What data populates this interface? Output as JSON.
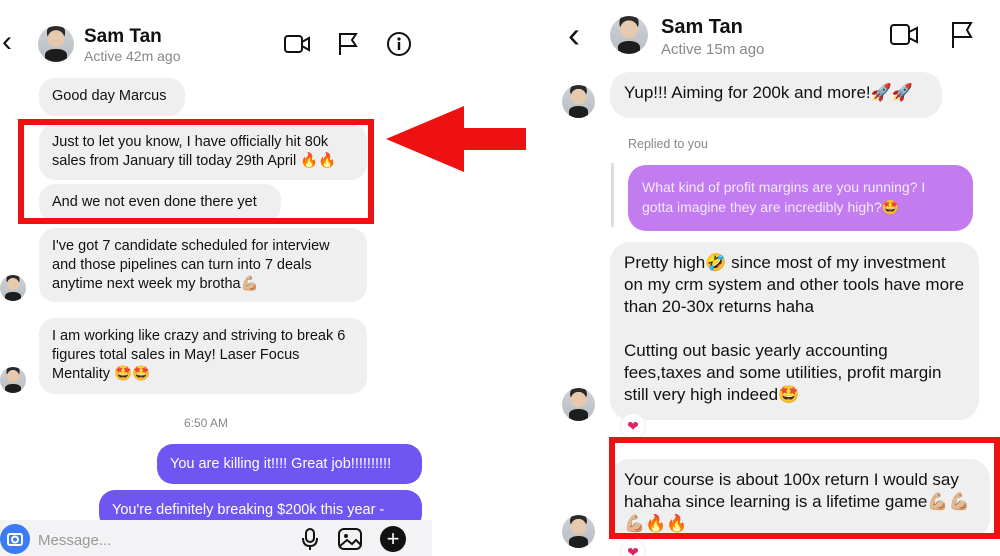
{
  "left": {
    "header": {
      "name": "Sam Tan",
      "status": "Active 42m ago"
    },
    "messages": [
      "Good day Marcus",
      "Just to let you know, I have officially hit 80k sales from January till today 29th April",
      "And we not even done there yet",
      "I've got 7 candidate scheduled for interview and those pipelines can turn into 7 deals anytime next week my brotha",
      "I am working like crazy and striving to break 6 figures total sales in May! Laser Focus Mentality"
    ],
    "time": "6:50 AM",
    "sent": [
      "You are killing it!!!! Great job!!!!!!!!!!",
      "You're definitely breaking $200k this year -"
    ],
    "composer_placeholder": "Message..."
  },
  "right": {
    "header": {
      "name": "Sam Tan",
      "status": "Active 15m ago"
    },
    "msg1": "Yup!!! Aiming for 200k and more!",
    "replied_label": "Replied to you",
    "quoted": "What kind of profit margins are you running? I gotta imagine they are incredibly high?",
    "msg2_p1": "Pretty high",
    "msg2_p1b": " since most of my investment on my crm system and other tools have more than 20-30x returns haha",
    "msg2_p2": "Cutting out basic yearly accounting fees,taxes and some utilities, profit margin still very high indeed",
    "msg3": "Your course is about 100x return I would say hahaha since learning is a lifetime game"
  },
  "colors": {
    "accent": "#6f55f2",
    "highlight": "#ee1111",
    "quoted_bubble": "#c27cf0",
    "incoming": "#efefef"
  }
}
